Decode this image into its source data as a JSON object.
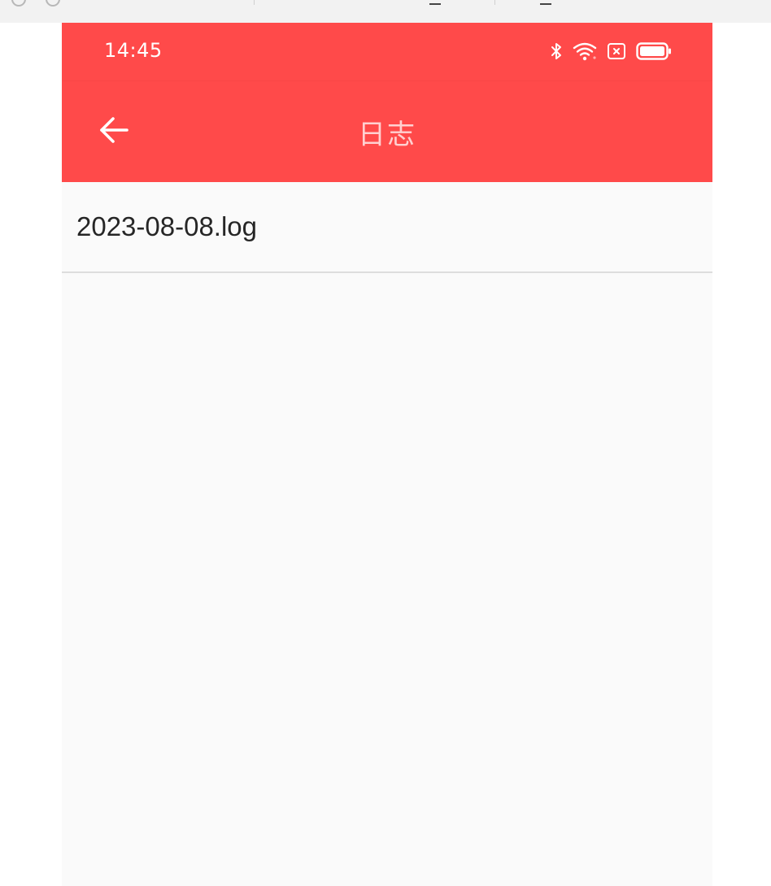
{
  "status_bar": {
    "time": "14:45",
    "icons": [
      "bluetooth-icon",
      "wifi-icon",
      "sim-off-icon",
      "battery-icon"
    ]
  },
  "app_bar": {
    "back_icon": "arrow-left-icon",
    "title": "日志"
  },
  "log_list": {
    "items": [
      {
        "label": "2023-08-08.log"
      }
    ]
  },
  "colors": {
    "accent": "#ff4a4a",
    "title_text": "#ffd0d0",
    "background": "#fafafa",
    "divider": "#dddddd",
    "item_text": "#262626"
  }
}
